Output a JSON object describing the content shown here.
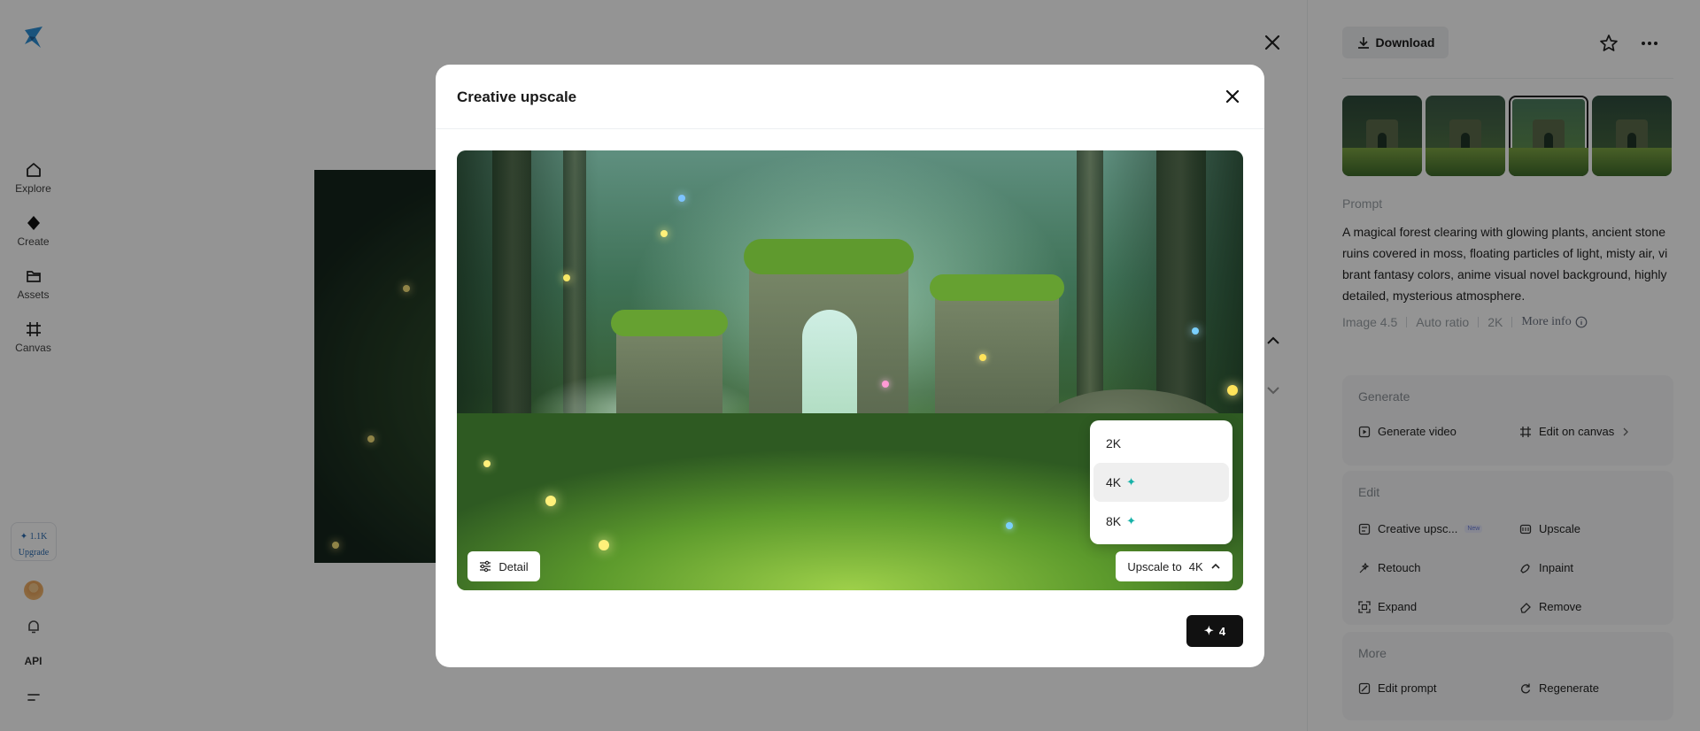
{
  "sidebar": {
    "nav": [
      {
        "label": "Explore",
        "icon": "home-icon"
      },
      {
        "label": "Create",
        "icon": "diamond-icon"
      },
      {
        "label": "Assets",
        "icon": "folder-icon"
      },
      {
        "label": "Canvas",
        "icon": "canvas-icon"
      }
    ],
    "credits": {
      "amount": "✦ 1.1K",
      "upgrade": "Upgrade"
    },
    "api_label": "API"
  },
  "panel": {
    "download_label": "Download",
    "prompt_label": "Prompt",
    "prompt_text": "A magical forest clearing with glowing plants, ancient stone ruins covered in moss, floating particles of light, misty air, vibrant fantasy colors, anime visual novel background, highly detailed, mysterious atmosphere.",
    "meta": {
      "model": "Image 4.5",
      "ratio": "Auto ratio",
      "resolution": "2K",
      "more_info": "More info"
    },
    "generate": {
      "title": "Generate",
      "video": "Generate video",
      "canvas": "Edit on canvas"
    },
    "edit": {
      "title": "Edit",
      "creative_upscale": "Creative upsc...",
      "new_badge": "New",
      "upscale": "Upscale",
      "retouch": "Retouch",
      "inpaint": "Inpaint",
      "expand": "Expand",
      "remove": "Remove"
    },
    "more": {
      "title": "More",
      "edit_prompt": "Edit prompt",
      "regenerate": "Regenerate"
    }
  },
  "modal": {
    "title": "Creative upscale",
    "detail_label": "Detail",
    "upscale_prefix": "Upscale to",
    "upscale_value": "4K",
    "options": [
      {
        "label": "2K",
        "premium": false
      },
      {
        "label": "4K",
        "premium": true,
        "selected": true
      },
      {
        "label": "8K",
        "premium": true
      }
    ],
    "cost": "4",
    "accent_color": "#17b2a8"
  }
}
